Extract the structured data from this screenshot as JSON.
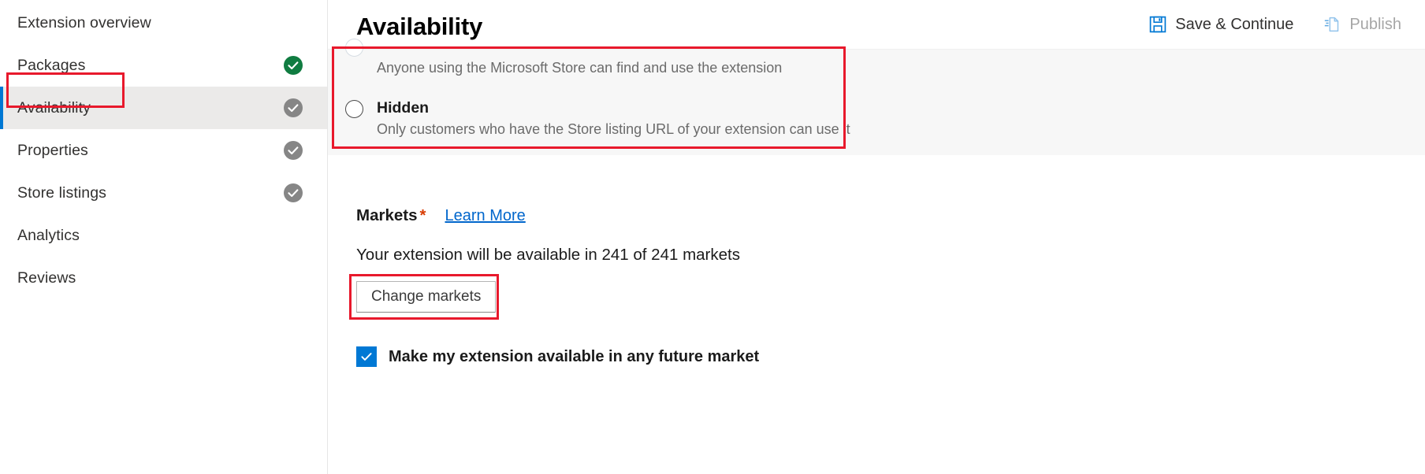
{
  "sidebar": {
    "items": [
      {
        "label": "Extension overview",
        "status": "none",
        "selected": false
      },
      {
        "label": "Packages",
        "status": "complete",
        "selected": false
      },
      {
        "label": "Availability",
        "status": "pending",
        "selected": true
      },
      {
        "label": "Properties",
        "status": "pending",
        "selected": false
      },
      {
        "label": "Store listings",
        "status": "pending",
        "selected": false
      },
      {
        "label": "Analytics",
        "status": "none",
        "selected": false
      },
      {
        "label": "Reviews",
        "status": "none",
        "selected": false
      }
    ]
  },
  "header": {
    "title": "Availability"
  },
  "commands": {
    "save": {
      "label": "Save & Continue",
      "icon": "save-disk-icon",
      "disabled": false
    },
    "publish": {
      "label": "Publish",
      "icon": "publish-document-icon",
      "disabled": true
    }
  },
  "availability": {
    "public_description": "Anyone using the Microsoft Store can find and use the extension",
    "hidden_label": "Hidden",
    "hidden_description": "Only customers who have the Store listing URL of your extension can use it"
  },
  "markets": {
    "title": "Markets",
    "required_marker": "*",
    "learn_more": "Learn More",
    "summary": "Your extension will be available in 241 of 241 markets",
    "change_button": "Change markets",
    "future_market_label": "Make my extension available in any future market",
    "future_market_checked": true,
    "available_count": 241,
    "total_count": 241
  },
  "colors": {
    "accent": "#0078d4",
    "complete": "#107c41",
    "pending": "#868686",
    "annotation": "#e8192c",
    "link": "#0066cc",
    "required": "#d83b01"
  }
}
